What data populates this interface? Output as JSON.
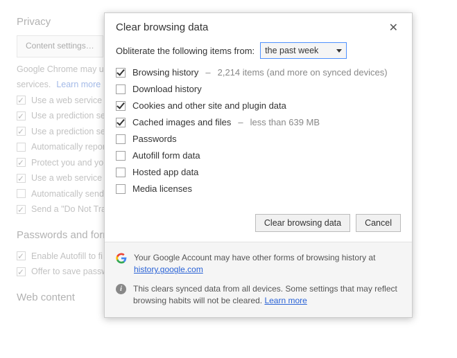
{
  "bg": {
    "privacy_heading": "Privacy",
    "content_settings_btn": "Content settings…",
    "desc_prefix": "Google Chrome may us",
    "desc_suffix": "services. ",
    "learn_more": "Learn more",
    "items": [
      {
        "label": "Use a web service t",
        "checked": true
      },
      {
        "label": "Use a prediction ser",
        "checked": true
      },
      {
        "label": "Use a prediction ser",
        "checked": true
      },
      {
        "label": "Automatically repor",
        "checked": false
      },
      {
        "label": "Protect you and you",
        "checked": true
      },
      {
        "label": "Use a web service t",
        "checked": true
      },
      {
        "label": "Automatically send",
        "checked": false
      },
      {
        "label": "Send a \"Do Not Tra",
        "checked": true
      }
    ],
    "pw_heading": "Passwords and forms",
    "pw_items": [
      {
        "label": "Enable Autofill to fi",
        "checked": true
      },
      {
        "label": "Offer to save passw",
        "checked": true
      }
    ],
    "web_heading": "Web content"
  },
  "dialog": {
    "title": "Clear browsing data",
    "from_label": "Obliterate the following items from:",
    "timerange_selected": "the past week",
    "checks": [
      {
        "label": "Browsing history",
        "checked": true,
        "hint_sep": "–",
        "hint": "2,214 items (and more on synced devices)"
      },
      {
        "label": "Download history",
        "checked": false,
        "hint_sep": "",
        "hint": ""
      },
      {
        "label": "Cookies and other site and plugin data",
        "checked": true,
        "hint_sep": "",
        "hint": ""
      },
      {
        "label": "Cached images and files",
        "checked": true,
        "hint_sep": "–",
        "hint": "less than 639 MB"
      },
      {
        "label": "Passwords",
        "checked": false,
        "hint_sep": "",
        "hint": ""
      },
      {
        "label": "Autofill form data",
        "checked": false,
        "hint_sep": "",
        "hint": ""
      },
      {
        "label": "Hosted app data",
        "checked": false,
        "hint_sep": "",
        "hint": ""
      },
      {
        "label": "Media licenses",
        "checked": false,
        "hint_sep": "",
        "hint": ""
      }
    ],
    "primary_btn": "Clear browsing data",
    "cancel_btn": "Cancel",
    "info1_text": "Your Google Account may have other forms of browsing history at ",
    "info1_link": "history.google.com",
    "info2_text": "This clears synced data from all devices. Some settings that may reflect browsing habits will not be cleared. ",
    "info2_link": "Learn more"
  }
}
